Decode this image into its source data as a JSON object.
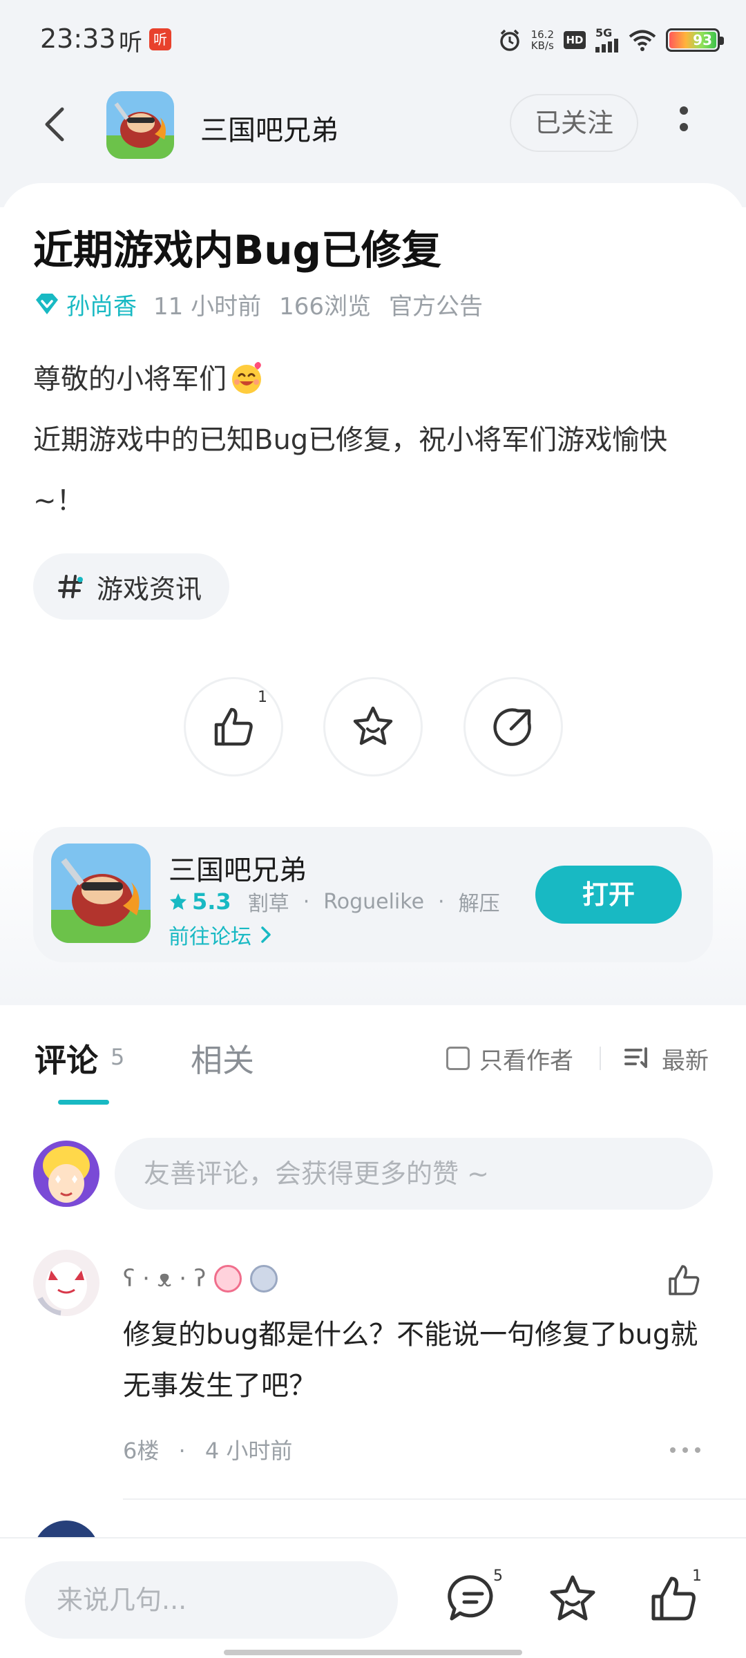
{
  "status_bar": {
    "time": "23:33",
    "listen_label": "听",
    "app_badge": "听",
    "net_speed_value": "16.2",
    "net_speed_unit": "KB/s",
    "hd_label": "HD",
    "signal_label": "5G",
    "battery_level": "93"
  },
  "header": {
    "title": "三国吧兄弟",
    "follow_label": "已关注"
  },
  "post": {
    "title": "近期游戏内Bug已修复",
    "author": "孙尚香",
    "time_ago": "11 小时前",
    "views": "166浏览",
    "category": "官方公告",
    "greeting": "尊敬的小将军们",
    "body": "近期游戏中的已知Bug已修复，祝小将军们游戏愉快~！",
    "tag": "游戏资讯",
    "like_count": "1"
  },
  "game_card": {
    "name": "三国吧兄弟",
    "rating": "5.3",
    "tags": [
      "割草",
      "Roguelike",
      "解压"
    ],
    "tag_separator": "·",
    "forum_link": "前往论坛",
    "open_label": "打开"
  },
  "comments": {
    "tab_label": "评论",
    "count": "5",
    "related_label": "相关",
    "author_only_label": "只看作者",
    "sort_label": "最新",
    "input_placeholder": "友善评论，会获得更多的赞 ~",
    "items": [
      {
        "username": "ʕ · ᴥ · ʔ",
        "text": "修复的bug都是什么？不能说一句修复了bug就无事发生了吧？",
        "floor": "6楼",
        "separator": "·",
        "time": "4 小时前"
      }
    ]
  },
  "bottom_bar": {
    "input_placeholder": "来说几句...",
    "comment_count": "5",
    "like_count": "1"
  },
  "colors": {
    "accent": "#18b9c3",
    "background_gray": "#f2f4f7"
  }
}
